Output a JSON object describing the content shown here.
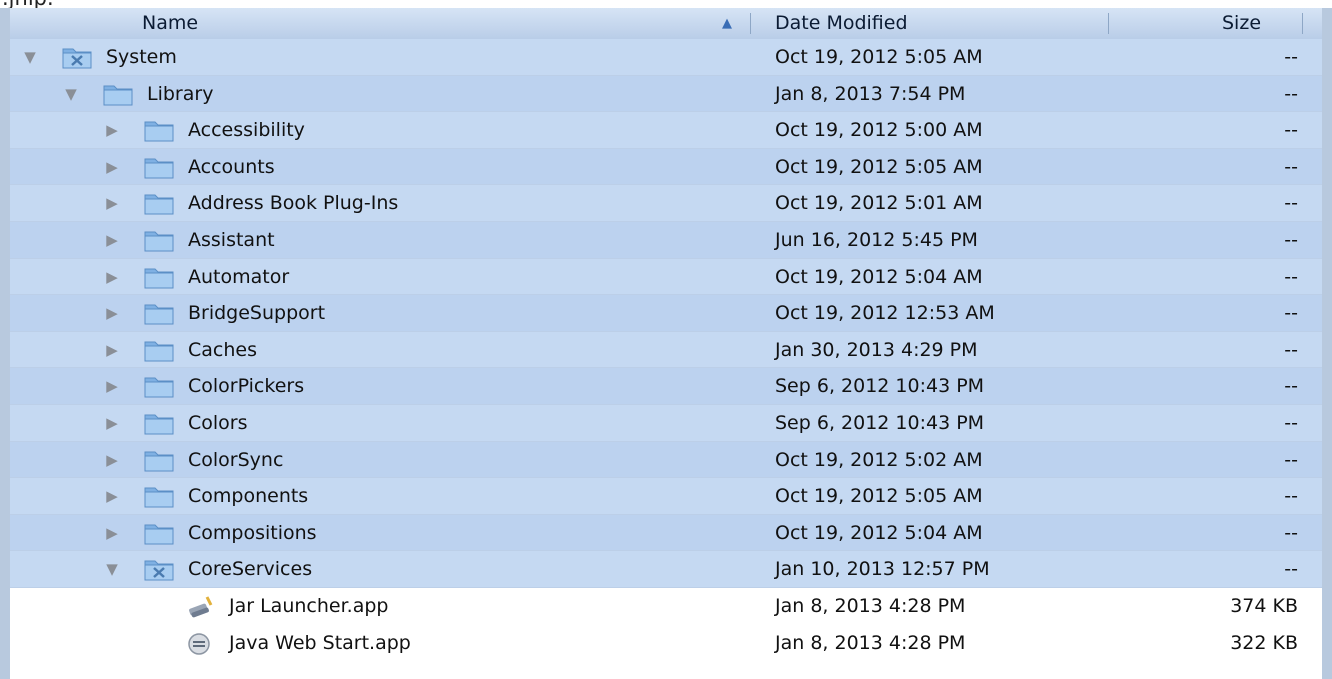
{
  "top_fragment": ".jnlp.",
  "columns": {
    "name": "Name",
    "date": "Date Modified",
    "size": "Size"
  },
  "rows": [
    {
      "name": "System",
      "date": "Oct 19, 2012 5:05 AM",
      "size": "--",
      "depth": 0,
      "disclosure": "expanded",
      "icon": "system-folder-icon",
      "selected": true
    },
    {
      "name": "Library",
      "date": "Jan 8, 2013 7:54 PM",
      "size": "--",
      "depth": 1,
      "disclosure": "expanded",
      "icon": "folder-icon",
      "selected": true
    },
    {
      "name": "Accessibility",
      "date": "Oct 19, 2012 5:00 AM",
      "size": "--",
      "depth": 2,
      "disclosure": "collapsed",
      "icon": "folder-icon",
      "selected": true
    },
    {
      "name": "Accounts",
      "date": "Oct 19, 2012 5:05 AM",
      "size": "--",
      "depth": 2,
      "disclosure": "collapsed",
      "icon": "folder-icon",
      "selected": true
    },
    {
      "name": "Address Book Plug-Ins",
      "date": "Oct 19, 2012 5:01 AM",
      "size": "--",
      "depth": 2,
      "disclosure": "collapsed",
      "icon": "folder-icon",
      "selected": true
    },
    {
      "name": "Assistant",
      "date": "Jun 16, 2012 5:45 PM",
      "size": "--",
      "depth": 2,
      "disclosure": "collapsed",
      "icon": "folder-icon",
      "selected": true
    },
    {
      "name": "Automator",
      "date": "Oct 19, 2012 5:04 AM",
      "size": "--",
      "depth": 2,
      "disclosure": "collapsed",
      "icon": "folder-icon",
      "selected": true
    },
    {
      "name": "BridgeSupport",
      "date": "Oct 19, 2012 12:53 AM",
      "size": "--",
      "depth": 2,
      "disclosure": "collapsed",
      "icon": "folder-icon",
      "selected": true
    },
    {
      "name": "Caches",
      "date": "Jan 30, 2013 4:29 PM",
      "size": "--",
      "depth": 2,
      "disclosure": "collapsed",
      "icon": "folder-icon",
      "selected": true
    },
    {
      "name": "ColorPickers",
      "date": "Sep 6, 2012 10:43 PM",
      "size": "--",
      "depth": 2,
      "disclosure": "collapsed",
      "icon": "folder-icon",
      "selected": true
    },
    {
      "name": "Colors",
      "date": "Sep 6, 2012 10:43 PM",
      "size": "--",
      "depth": 2,
      "disclosure": "collapsed",
      "icon": "folder-icon",
      "selected": true
    },
    {
      "name": "ColorSync",
      "date": "Oct 19, 2012 5:02 AM",
      "size": "--",
      "depth": 2,
      "disclosure": "collapsed",
      "icon": "folder-icon",
      "selected": true
    },
    {
      "name": "Components",
      "date": "Oct 19, 2012 5:05 AM",
      "size": "--",
      "depth": 2,
      "disclosure": "collapsed",
      "icon": "folder-icon",
      "selected": true
    },
    {
      "name": "Compositions",
      "date": "Oct 19, 2012 5:04 AM",
      "size": "--",
      "depth": 2,
      "disclosure": "collapsed",
      "icon": "folder-icon",
      "selected": true
    },
    {
      "name": "CoreServices",
      "date": "Jan 10, 2013 12:57 PM",
      "size": "--",
      "depth": 2,
      "disclosure": "expanded",
      "icon": "system-folder-icon",
      "selected": true
    },
    {
      "name": "Jar Launcher.app",
      "date": "Jan 8, 2013 4:28 PM",
      "size": "374 KB",
      "depth": 3,
      "disclosure": "none",
      "icon": "jar-launcher-icon",
      "selected": false
    },
    {
      "name": "Java Web Start.app",
      "date": "Jan 8, 2013 4:28 PM",
      "size": "322 KB",
      "depth": 3,
      "disclosure": "none",
      "icon": "java-web-start-icon",
      "selected": false
    }
  ],
  "colors": {
    "selection": "#c5d9f2",
    "frame": "#b8c9de",
    "folder": "#8fb9e6"
  }
}
